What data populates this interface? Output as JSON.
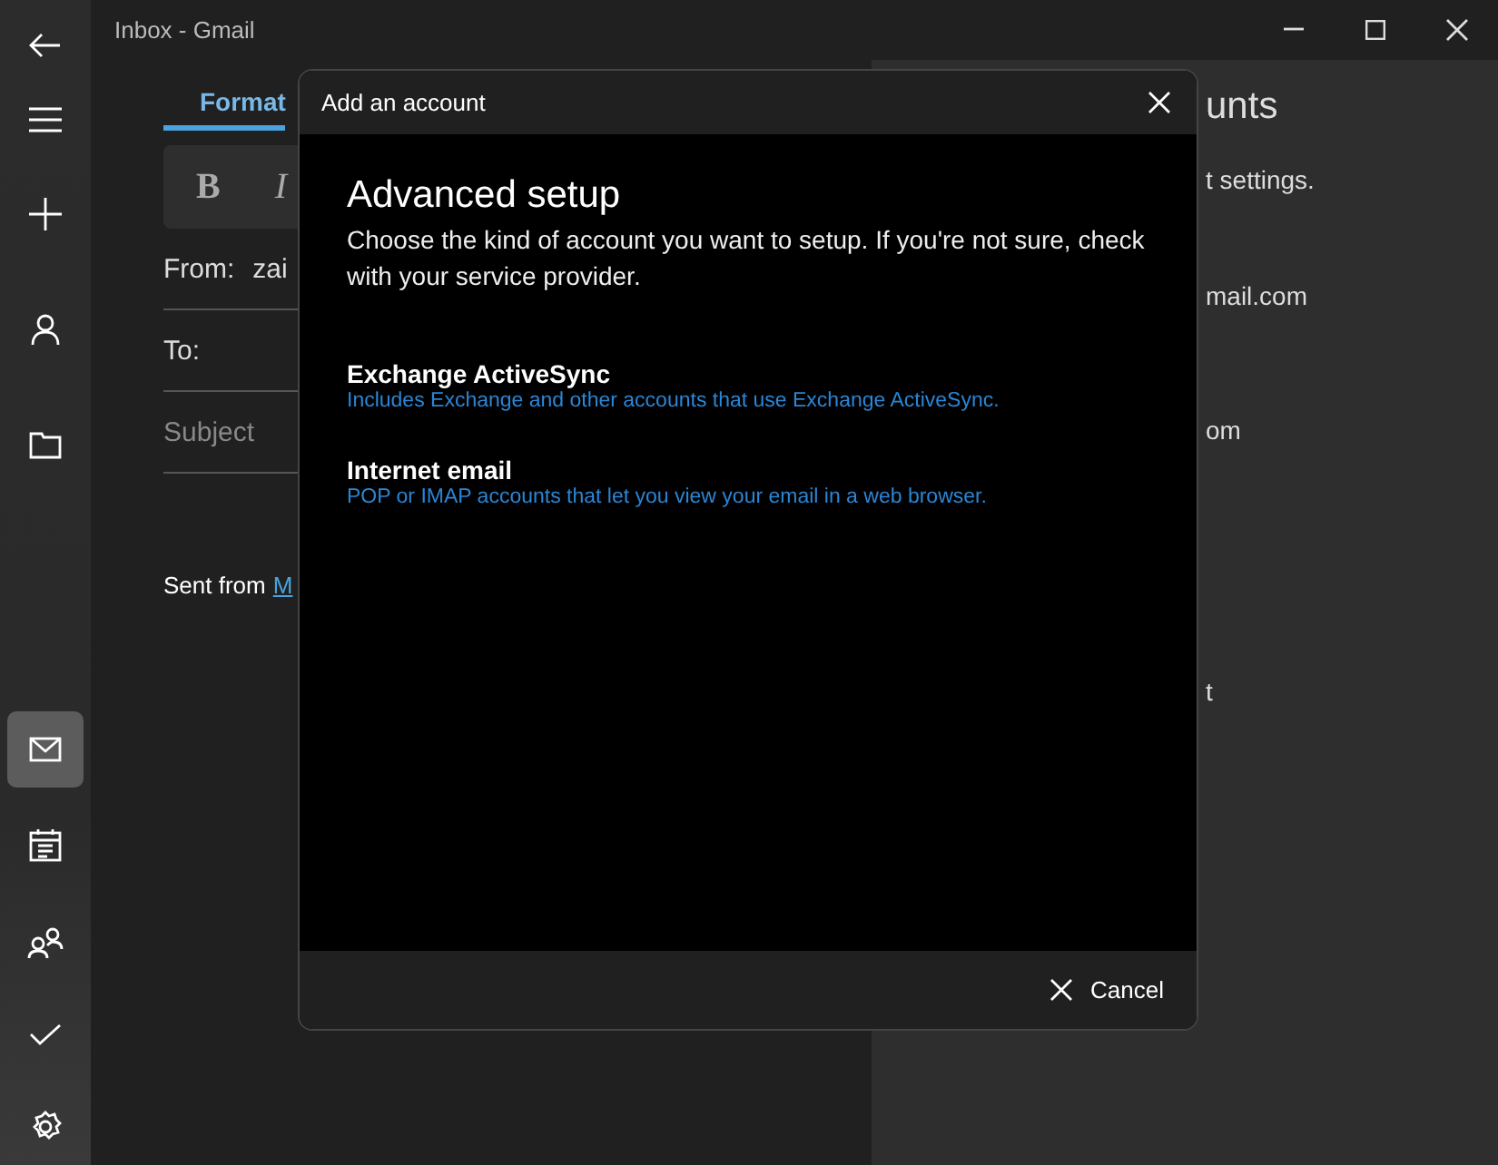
{
  "window": {
    "title": "Inbox - Gmail"
  },
  "rail": [
    {
      "kind": "back",
      "selected": false
    },
    {
      "kind": "menu",
      "selected": false
    },
    {
      "kind": "new",
      "selected": false
    },
    {
      "kind": "account",
      "selected": false
    },
    {
      "kind": "folder",
      "selected": false
    },
    {
      "kind": "mail",
      "selected": true
    },
    {
      "kind": "calendar",
      "selected": false
    },
    {
      "kind": "people",
      "selected": false
    },
    {
      "kind": "todo",
      "selected": false
    },
    {
      "kind": "settings",
      "selected": false
    }
  ],
  "compose": {
    "tab": "Format",
    "bold": "B",
    "italic": "I",
    "from_label": "From:",
    "from_value": "zai",
    "to_label": "To:",
    "subject_placeholder": "Subject",
    "signature": "Sent from",
    "signature_link": "M"
  },
  "accounts_panel": {
    "title": "unts",
    "lines": [
      "t settings.",
      "mail.com",
      "om",
      "t"
    ]
  },
  "dialog": {
    "title": "Add an account",
    "heading": "Advanced setup",
    "intro": "Choose the kind of account you want to setup. If you're not sure, check with your service provider.",
    "options": [
      {
        "title": "Exchange ActiveSync",
        "description": "Includes Exchange and other accounts that use Exchange ActiveSync."
      },
      {
        "title": "Internet email",
        "description": "POP or IMAP accounts that let you view your email in a web browser."
      }
    ],
    "cancel": "Cancel"
  }
}
